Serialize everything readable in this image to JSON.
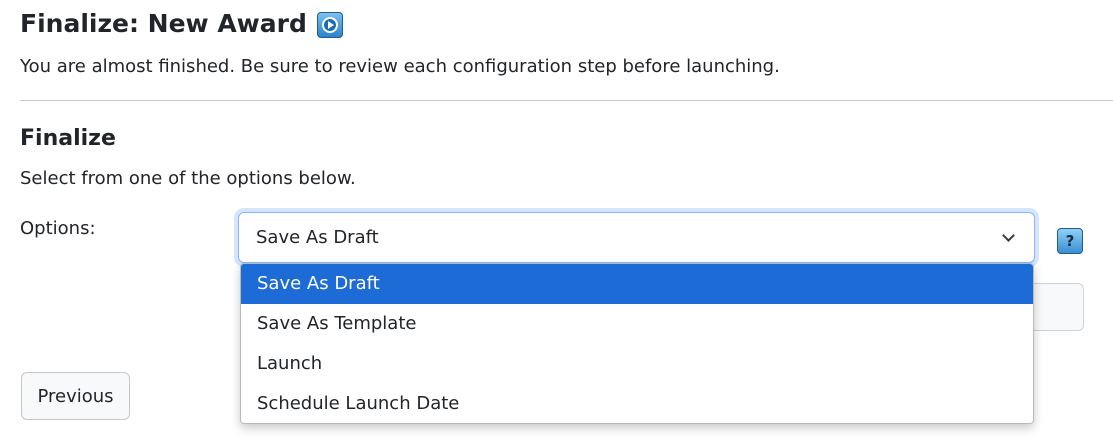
{
  "header": {
    "title": "Finalize: New Award",
    "intro": "You are almost finished. Be sure to review each configuration step before launching."
  },
  "icons": {
    "title_icon": "video-play-icon",
    "help_icon": "help-question-icon",
    "help_glyph": "?"
  },
  "section": {
    "title": "Finalize",
    "description": "Select from one of the options below."
  },
  "form": {
    "options_label": "Options:",
    "selected_value": "Save As Draft",
    "options": [
      "Save As Draft",
      "Save As Template",
      "Launch",
      "Schedule Launch Date"
    ]
  },
  "footer": {
    "previous_label": "Previous"
  },
  "colors": {
    "highlight": "#1c6bd6",
    "focus_border": "#86b7fe",
    "text": "#212529"
  }
}
